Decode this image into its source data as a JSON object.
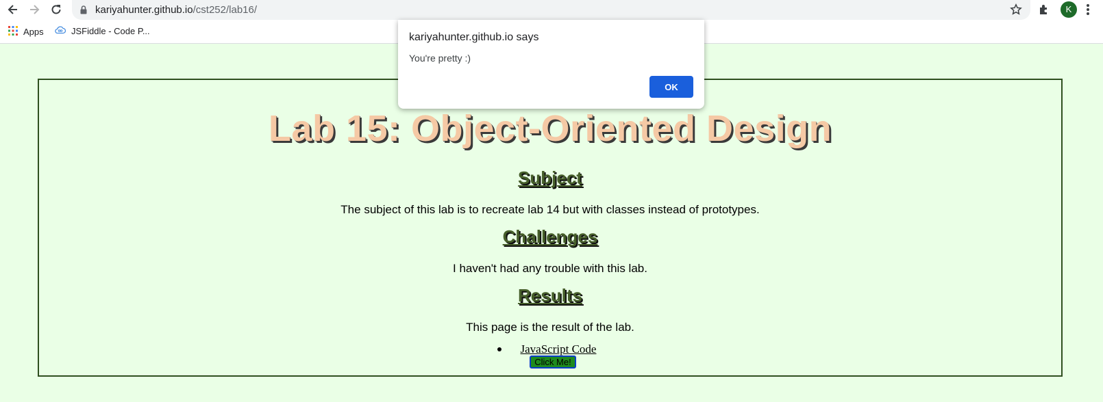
{
  "browser": {
    "url_host": "kariyahunter.github.io",
    "url_path": "/cst252/lab16/",
    "profile_initial": "K",
    "bookmarks": [
      {
        "label": "Apps",
        "icon": "apps-grid-icon"
      },
      {
        "label": "JSFiddle - Code P...",
        "icon": "jsfiddle-icon"
      }
    ]
  },
  "page": {
    "title": "Lab 15: Object-Oriented Design",
    "sections": [
      {
        "heading": "Subject",
        "text": "The subject of this lab is to recreate lab 14 but with classes instead of prototypes."
      },
      {
        "heading": "Challenges",
        "text": "I haven't had any trouble with this lab."
      },
      {
        "heading": "Results",
        "text": "This page is the result of the lab."
      }
    ],
    "links": [
      {
        "label": "JavaScript Code"
      }
    ],
    "button_label": "Click Me!"
  },
  "dialog": {
    "title": "kariyahunter.github.io says",
    "message": "You're pretty :)",
    "ok_label": "OK"
  },
  "colors": {
    "page_background": "#eaffe6",
    "title": "#f5c9a5",
    "heading": "#465e2a",
    "box_border": "#2f4f1f",
    "button": "#1e8a1e",
    "dialog_ok": "#1a5fdc"
  }
}
